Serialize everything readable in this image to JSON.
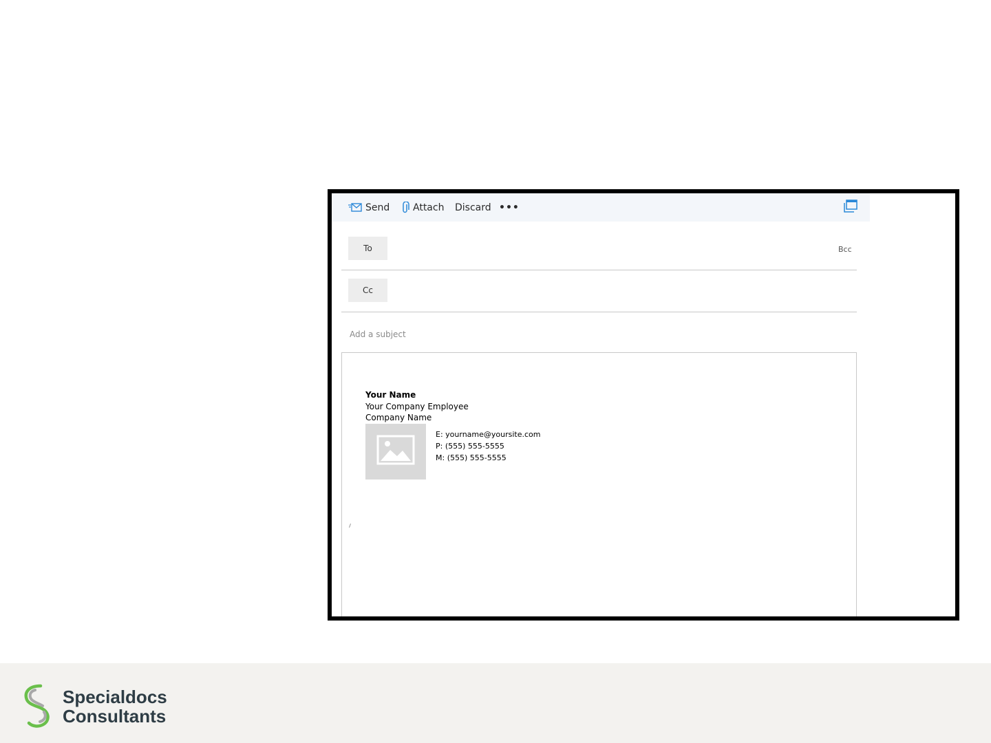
{
  "compose": {
    "toolbar": {
      "send_label": "Send",
      "attach_label": "Attach",
      "discard_label": "Discard",
      "more_label": "•••",
      "icons": {
        "send": "send-mail-icon",
        "attach": "paperclip-icon",
        "popout": "popout-window-icon"
      },
      "icon_color": "#2b88d8"
    },
    "to_label": "To",
    "cc_label": "Cc",
    "bcc_label": "Bcc",
    "subject_placeholder": "Add a subject",
    "signature": {
      "name": "Your Name",
      "title": "Your Company Employee",
      "company": "Company Name",
      "photo_icon": "image-placeholder-icon",
      "email": "E: yourname@yoursite.com",
      "phone": "P: (555) 555-5555",
      "mobile": "M: (555) 555-5555"
    }
  },
  "footer": {
    "brand_line1": "Specialdocs",
    "brand_line2": "Consultants",
    "logo_icon": "specialdocs-s-logo-icon",
    "colors": {
      "brand_green": "#6abf4b",
      "brand_gray": "#a8a8a8",
      "brand_text": "#2e3d45",
      "band": "#f3f2ef"
    }
  }
}
